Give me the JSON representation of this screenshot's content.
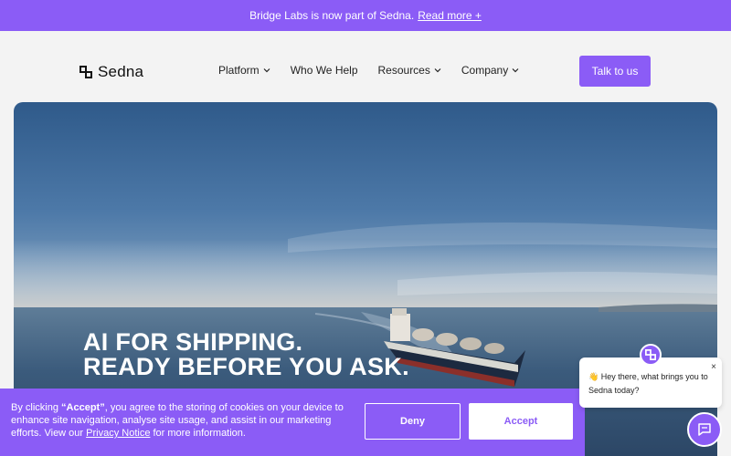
{
  "announcement": {
    "text": "Bridge Labs is now part of Sedna.",
    "link": "Read more +"
  },
  "nav": {
    "logo": "Sedna",
    "items": [
      {
        "label": "Platform",
        "dropdown": true
      },
      {
        "label": "Who We Help",
        "dropdown": false
      },
      {
        "label": "Resources",
        "dropdown": true
      },
      {
        "label": "Company",
        "dropdown": true
      }
    ],
    "cta": "Talk to us"
  },
  "hero": {
    "line1": "AI FOR SHIPPING.",
    "line2": "READY BEFORE YOU ASK."
  },
  "cookie": {
    "prefix": "By clicking ",
    "accept_quote": "“Accept”",
    "middle": ", you agree to the storing of cookies on your device to enhance site navigation, analyse site usage, and assist in our marketing efforts. View our ",
    "privacy": "Privacy Notice",
    "suffix": " for more information.",
    "deny": "Deny",
    "accept": "Accept"
  },
  "chat": {
    "emoji": "👋",
    "message": "Hey there, what brings you to Sedna today?",
    "close": "×"
  },
  "colors": {
    "accent": "#8b5cf6",
    "background": "#f3f3f3"
  },
  "icons": [
    "sedna-logo-icon",
    "chevron-down-icon",
    "close-icon",
    "chat-icon"
  ]
}
